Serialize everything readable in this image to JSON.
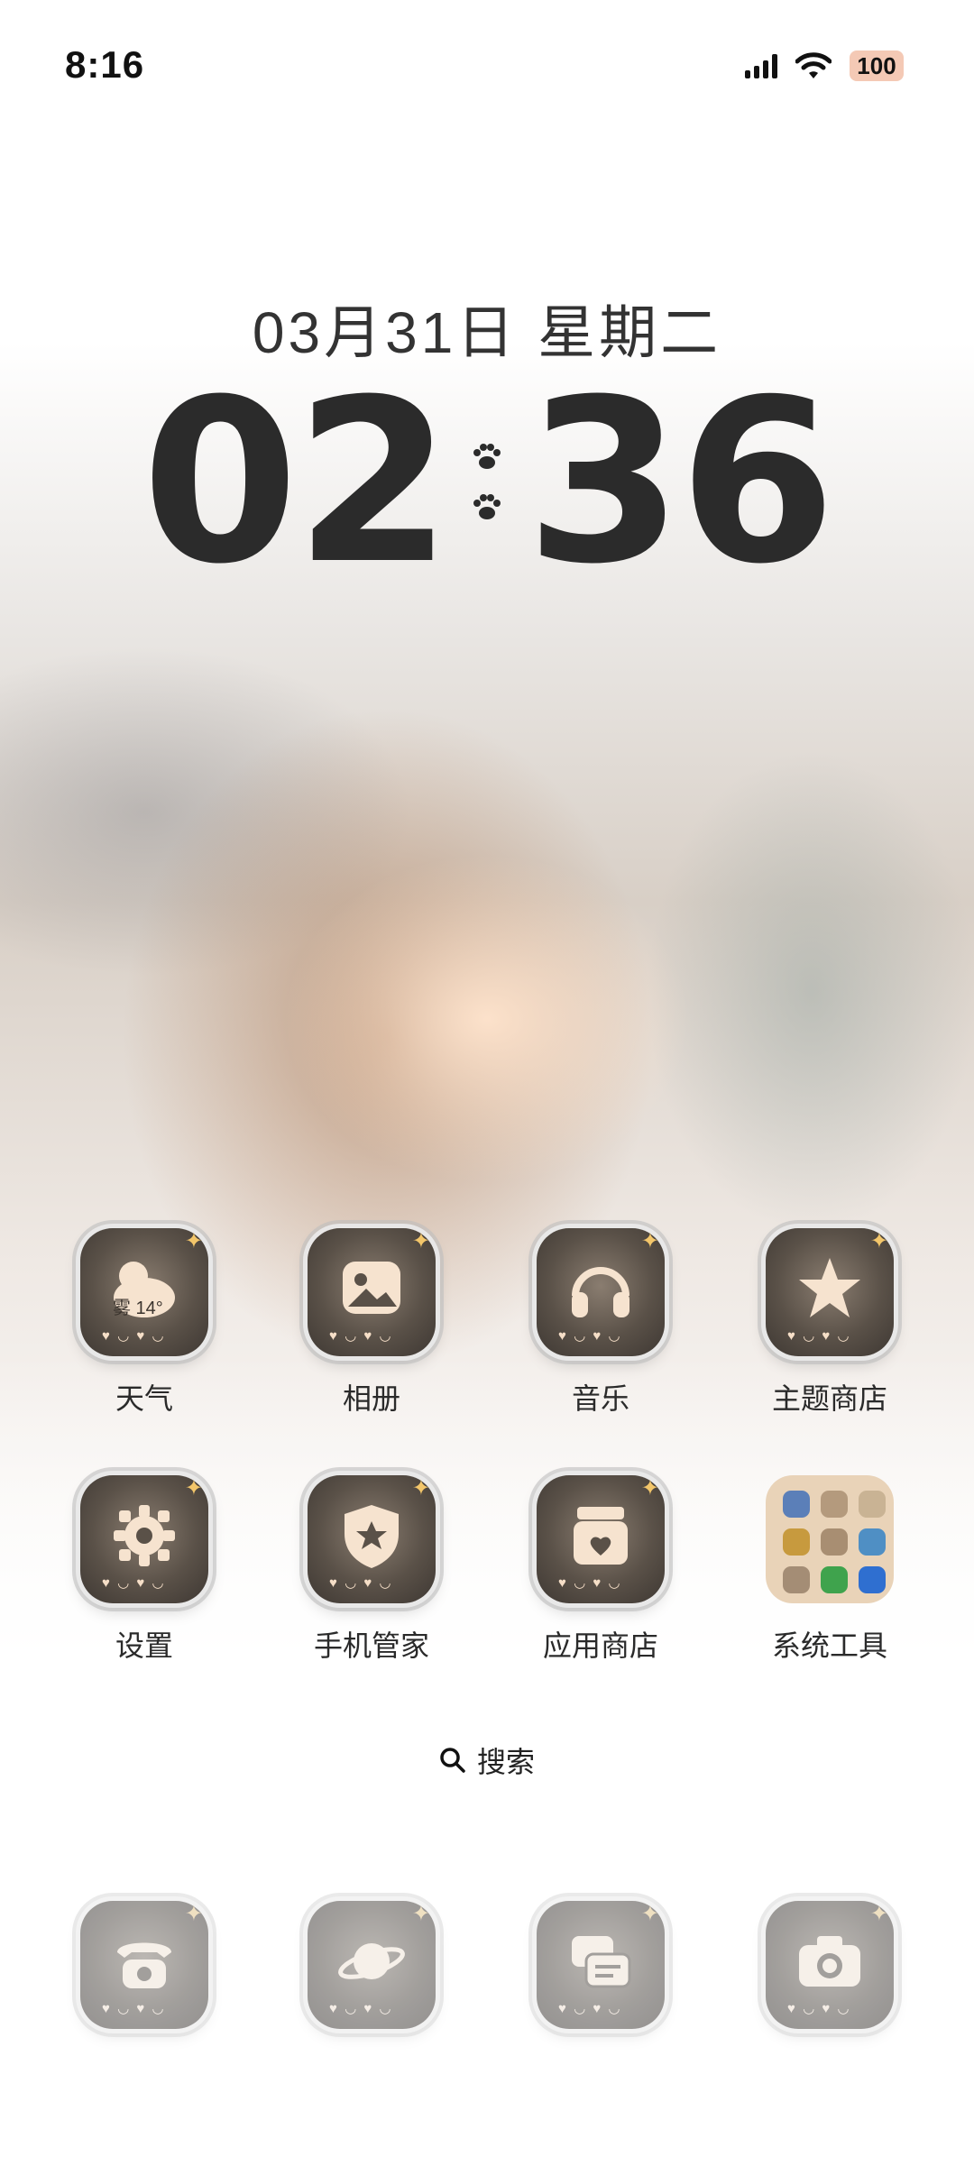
{
  "status_bar": {
    "time": "8:16",
    "battery": "100"
  },
  "clock_widget": {
    "date": "03月31日  星期二",
    "hours": "02",
    "minutes": "36"
  },
  "apps": [
    {
      "label": "天气",
      "icon": "weather-icon",
      "badge": "雾 14°"
    },
    {
      "label": "相册",
      "icon": "gallery-icon"
    },
    {
      "label": "音乐",
      "icon": "headphones-icon"
    },
    {
      "label": "主题商店",
      "icon": "star-icon"
    },
    {
      "label": "设置",
      "icon": "gear-icon"
    },
    {
      "label": "手机管家",
      "icon": "shield-icon"
    },
    {
      "label": "应用商店",
      "icon": "store-icon"
    },
    {
      "label": "系统工具",
      "icon": "folder-icon"
    }
  ],
  "search": {
    "label": "搜索"
  },
  "dock": [
    {
      "icon": "phone-icon"
    },
    {
      "icon": "planet-icon"
    },
    {
      "icon": "messages-icon"
    },
    {
      "icon": "camera-icon"
    }
  ],
  "colors": {
    "icon_base": "#5a5148",
    "glyph": "#f6e3cf",
    "folder_bg": "#e9d3b8",
    "clock_text": "#2b2b2b"
  }
}
